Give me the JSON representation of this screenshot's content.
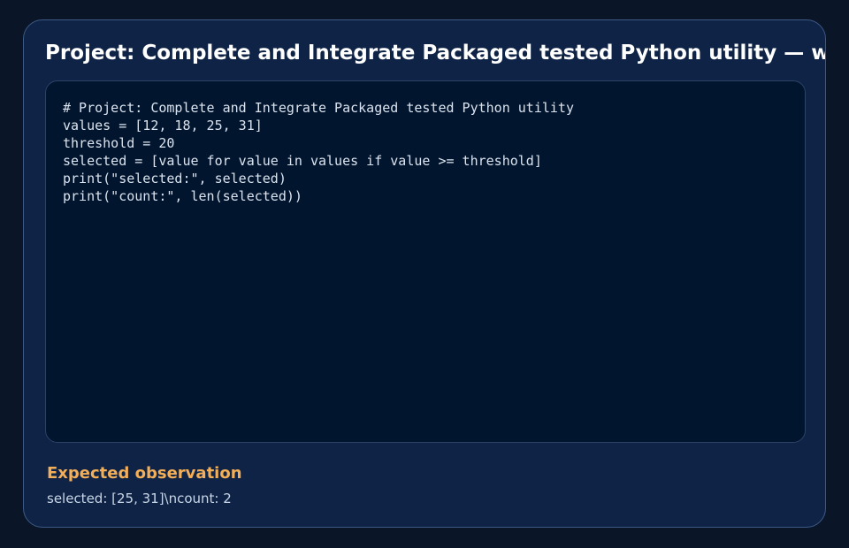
{
  "card": {
    "title": "Project: Complete and Integrate Packaged tested Python utility — w"
  },
  "code": {
    "lines": [
      "# Project: Complete and Integrate Packaged tested Python utility",
      "values = [12, 18, 25, 31]",
      "threshold = 20",
      "selected = [value for value in values if value >= threshold]",
      "print(\"selected:\", selected)",
      "print(\"count:\", len(selected))"
    ]
  },
  "observation": {
    "heading": "Expected observation",
    "value": "selected: [25, 31]\\ncount: 2"
  },
  "colors": {
    "background": "#0a1628",
    "card": "#0e2346",
    "code_panel": "#02152e",
    "accent_heading": "#f3ae58"
  }
}
